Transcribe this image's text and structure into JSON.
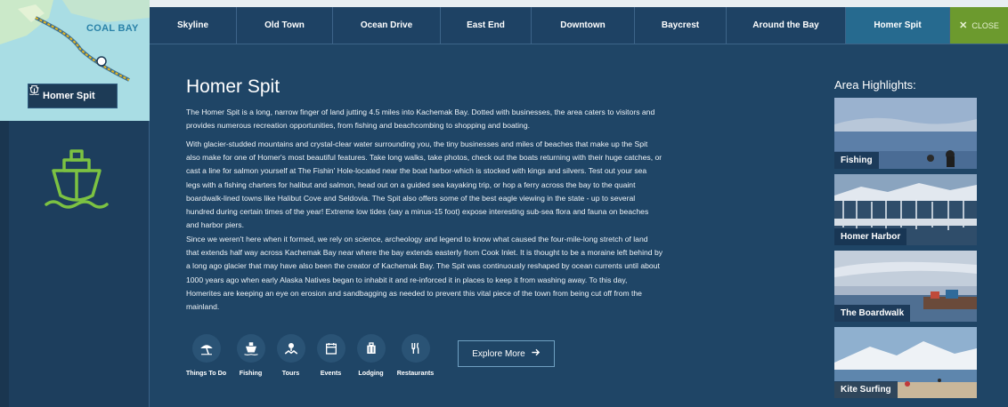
{
  "map": {
    "label": "COAL BAY",
    "route_marker": "1"
  },
  "location_tag": {
    "label": "Homer Spit"
  },
  "nav": {
    "items": [
      {
        "label": "Skyline"
      },
      {
        "label": "Old Town"
      },
      {
        "label": "Ocean Drive"
      },
      {
        "label": "East End"
      },
      {
        "label": "Downtown"
      },
      {
        "label": "Baycrest"
      },
      {
        "label": "Around the Bay"
      },
      {
        "label": "Homer Spit"
      }
    ],
    "active": "Homer Spit",
    "close_label": "CLOSE"
  },
  "main": {
    "title": "Homer Spit",
    "paragraphs": [
      "The Homer Spit is a long, narrow finger of land jutting 4.5 miles into Kachemak Bay. Dotted with businesses, the area caters to visitors and provides numerous recreation opportunities, from fishing and beachcombing to shopping and boating.",
      "With glacier-studded mountains and crystal-clear water surrounding you, the tiny businesses and miles of beaches that make up the Spit also make for one of Homer's most beautiful features. Take long walks, take photos, check out the boats returning with their huge catches, or cast a line for salmon yourself at The Fishin' Hole-located near the boat harbor-which is stocked with kings and silvers. Test out your sea legs with a fishing charters for halibut and salmon, head out on a guided sea kayaking trip, or hop a ferry across the bay to the quaint boardwalk-lined towns like Halibut Cove and Seldovia. The Spit also offers some of the best eagle viewing in the state - up to several hundred during certain times of the year! Extreme low tides (say a minus-15 foot) expose interesting sub-sea flora and fauna on beaches and harbor piers.",
      "Since we weren't here when it formed, we rely on science, archeology and legend to know what caused the four-mile-long stretch of land that extends half way across Kachemak Bay near where the bay extends easterly from Cook Inlet. It is thought to be a moraine left behind by a long ago glacier that may have also been the creator of Kachemak Bay. The Spit was continuously reshaped by ocean currents until about 1000 years ago when early Alaska Natives began to inhabit it and re-inforced it in places to keep it from washing away. To this day, Homerites are keeping an eye on erosion and sandbagging as needed to prevent this vital piece of the town from being cut off from the mainland."
    ],
    "categories": [
      {
        "label": "Things To Do",
        "icon": "umbrella-icon"
      },
      {
        "label": "Fishing",
        "icon": "ship-icon"
      },
      {
        "label": "Tours",
        "icon": "map-pin-icon"
      },
      {
        "label": "Events",
        "icon": "calendar-icon"
      },
      {
        "label": "Lodging",
        "icon": "luggage-icon"
      },
      {
        "label": "Restaurants",
        "icon": "fork-knife-icon"
      }
    ],
    "explore_label": "Explore More"
  },
  "highlights": {
    "title": "Area Highlights:",
    "cards": [
      {
        "label": "Fishing"
      },
      {
        "label": "Homer Harbor"
      },
      {
        "label": "The Boardwalk"
      },
      {
        "label": "Kite Surfing"
      }
    ]
  },
  "colors": {
    "background": "#1f4566",
    "active_tab": "#266a8f",
    "close_button": "#6c9a2e",
    "boat_icon": "#7cc242",
    "map_water": "#a9dde4"
  }
}
